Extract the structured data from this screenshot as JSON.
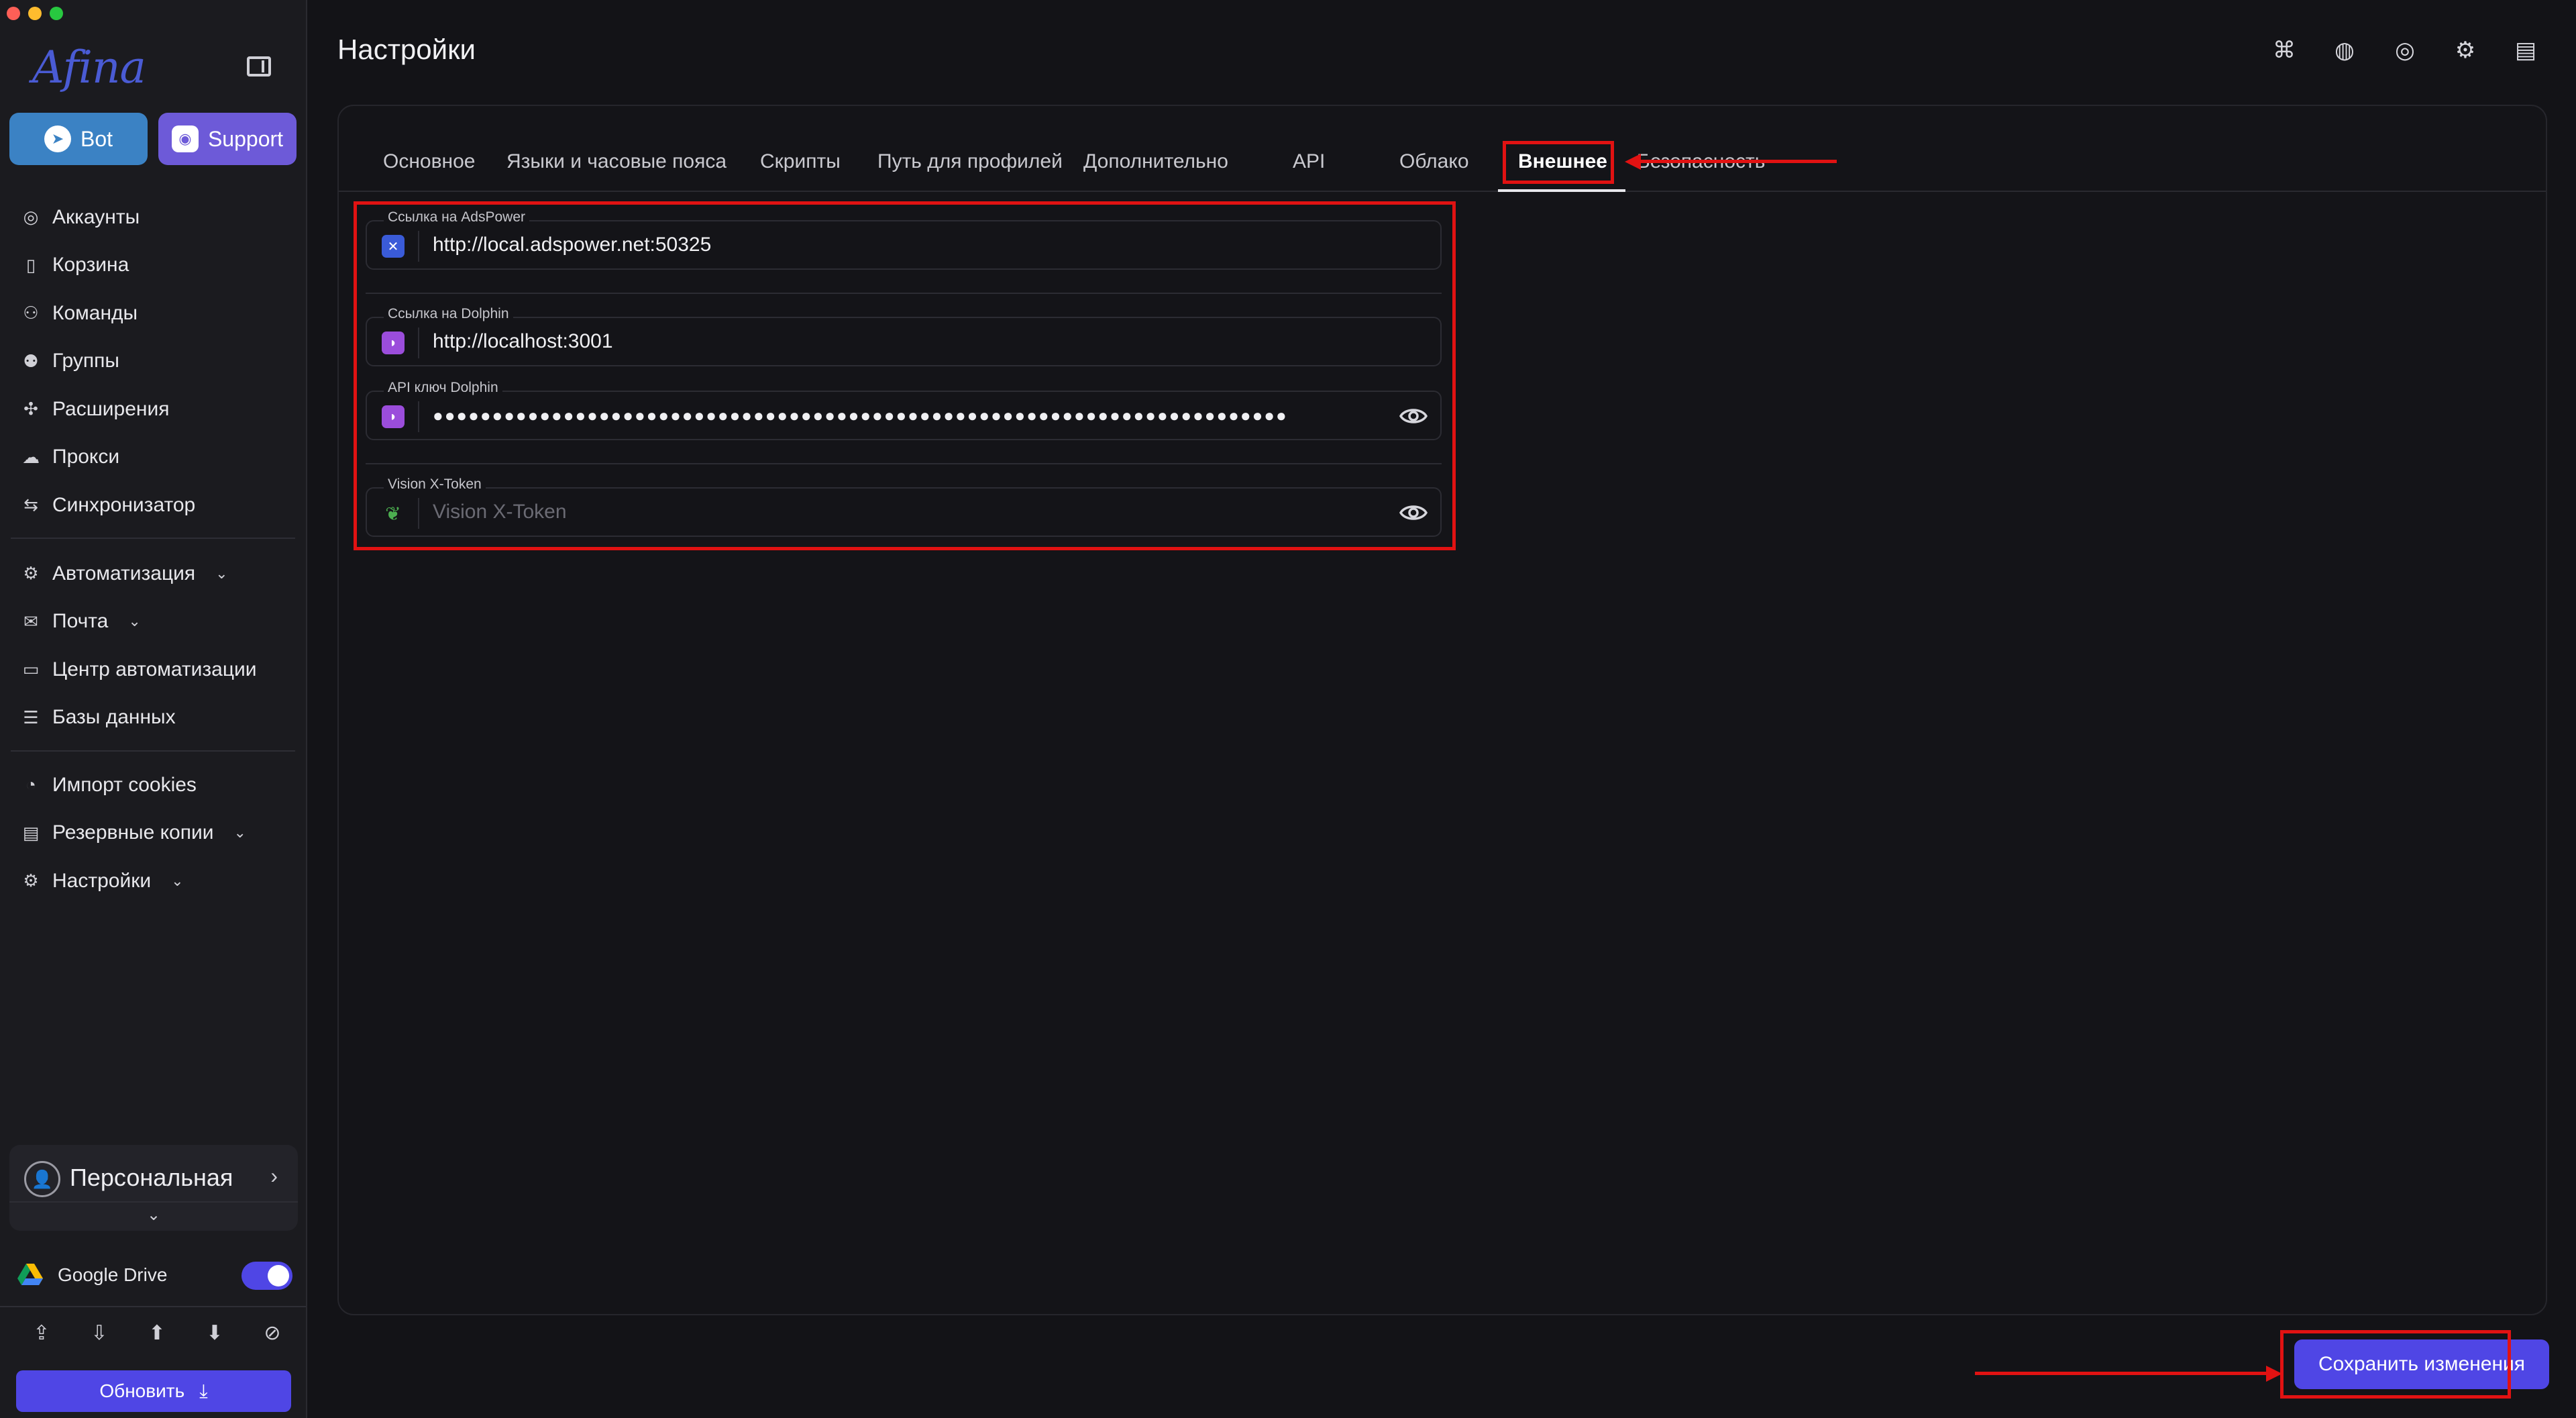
{
  "sidebar": {
    "logo": "Afina",
    "bot_label": "Bot",
    "support_label": "Support",
    "nav_main": [
      {
        "label": "Аккаунты",
        "icon": "user-circle-icon"
      },
      {
        "label": "Корзина",
        "icon": "trash-icon"
      },
      {
        "label": "Команды",
        "icon": "team-icon"
      },
      {
        "label": "Группы",
        "icon": "group-icon"
      },
      {
        "label": "Расширения",
        "icon": "puzzle-icon"
      },
      {
        "label": "Прокси",
        "icon": "cloud-icon"
      },
      {
        "label": "Синхронизатор",
        "icon": "sync-icon"
      }
    ],
    "nav_auto": [
      {
        "label": "Автоматизация",
        "icon": "automation-icon"
      },
      {
        "label": "Почта",
        "icon": "mail-icon"
      },
      {
        "label": "Центр автоматизации",
        "icon": "laptop-icon"
      },
      {
        "label": "Базы данных",
        "icon": "list-icon"
      }
    ],
    "nav_tools": [
      {
        "label": "Импорт cookies",
        "icon": "cookie-icon"
      },
      {
        "label": "Резервные копии",
        "icon": "backup-icon"
      },
      {
        "label": "Настройки",
        "icon": "gear-icon"
      }
    ],
    "profile_name": "Персональная",
    "google_drive_label": "Google Drive",
    "google_drive_enabled": true,
    "update_label": "Обновить"
  },
  "header": {
    "title": "Настройки"
  },
  "tabs": [
    {
      "label": "Основное",
      "active": false
    },
    {
      "label": "Языки и часовые пояса",
      "active": false
    },
    {
      "label": "Скрипты",
      "active": false
    },
    {
      "label": "Путь для профилей",
      "active": false
    },
    {
      "label": "Дополнительно",
      "active": false
    },
    {
      "label": "API",
      "active": false
    },
    {
      "label": "Облако",
      "active": false
    },
    {
      "label": "Внешнее",
      "active": true
    },
    {
      "label": "Безопасность",
      "active": false
    }
  ],
  "fields": {
    "adspower_label": "Ссылка на AdsPower",
    "adspower_value": "http://local.adspower.net:50325",
    "dolphin_label": "Ссылка на Dolphin",
    "dolphin_value": "http://localhost:3001",
    "dolphin_key_label": "API ключ Dolphin",
    "dolphin_key_value": "●●●●●●●●●●●●●●●●●●●●●●●●●●●●●●●●●●●●●●●●●●●●●●●●●●●●●●●●●●●●●●●●●●●●●●●●",
    "vision_label": "Vision X-Token",
    "vision_placeholder": "Vision X-Token"
  },
  "actions": {
    "save_label": "Сохранить изменения"
  },
  "colors": {
    "accent": "#4f46e5",
    "annotation": "#e11212",
    "bot": "#3b82c4",
    "support": "#6d5ad8"
  }
}
